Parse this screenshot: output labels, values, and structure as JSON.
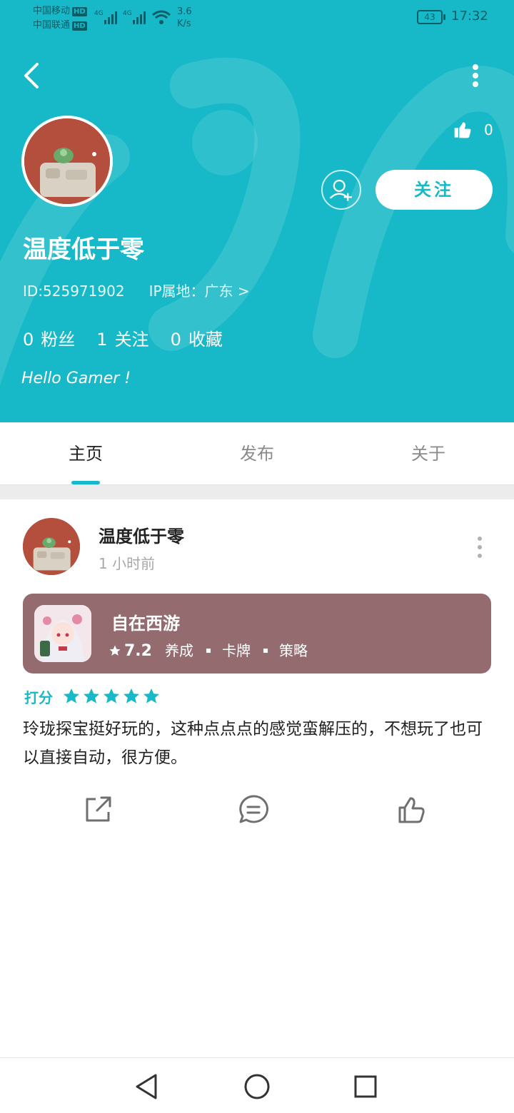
{
  "status_bar": {
    "carrier_1": "中国移动",
    "carrier_2": "中国联通",
    "hd": "HD",
    "network": "4G",
    "speed_value": "3.6",
    "speed_unit": "K/s",
    "battery": "43",
    "time": "17:32"
  },
  "profile": {
    "likes": "0",
    "follow_label": "关注",
    "username": "温度低于零",
    "id_text": "ID:525971902",
    "ip_text": "IP属地：广东 >",
    "fans_count": "0",
    "fans_label": "粉丝",
    "following_count": "1",
    "following_label": "关注",
    "favorites_count": "0",
    "favorites_label": "收藏",
    "bio": "Hello Gamer !"
  },
  "tabs": [
    {
      "label": "主页",
      "active": true
    },
    {
      "label": "发布",
      "active": false
    },
    {
      "label": "关于",
      "active": false
    }
  ],
  "post": {
    "author": "温度低于零",
    "time": "1 小时前",
    "game": {
      "name": "自在西游",
      "score": "7.2",
      "tags": [
        "养成",
        "卡牌",
        "策略"
      ]
    },
    "rating_label": "打分",
    "rating_stars": 5,
    "text": "玲珑探宝挺好玩的，这种点点点的感觉蛮解压的，不想玩了也可以直接自动，很方便。"
  },
  "colors": {
    "accent": "#17b9c8",
    "card": "#946c70"
  },
  "icons": [
    "back-icon",
    "more-icon",
    "thumb-up-icon",
    "add-friend-icon",
    "share-icon",
    "comment-icon",
    "like-icon",
    "nav-back-icon",
    "nav-home-icon",
    "nav-recent-icon"
  ]
}
